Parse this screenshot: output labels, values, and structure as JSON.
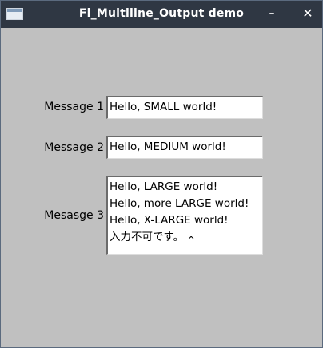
{
  "window": {
    "title": "Fl_Multiline_Output demo",
    "minimize_glyph": "–",
    "close_glyph": "✕"
  },
  "rows": [
    {
      "label": "Message 1",
      "lines": [
        "Hello, SMALL world!"
      ]
    },
    {
      "label": "Message 2",
      "lines": [
        "Hello, MEDIUM world!"
      ]
    },
    {
      "label": "Mesasge 3",
      "lines": [
        "Hello, LARGE world!",
        "Hello, more LARGE world!",
        "Hello, X-LARGE world!",
        "入力不可です。"
      ]
    }
  ],
  "caret_glyph": "^",
  "colors": {
    "titlebar": "#2f3743",
    "window_bg": "#c0c0c0",
    "field_bg": "#ffffff"
  }
}
